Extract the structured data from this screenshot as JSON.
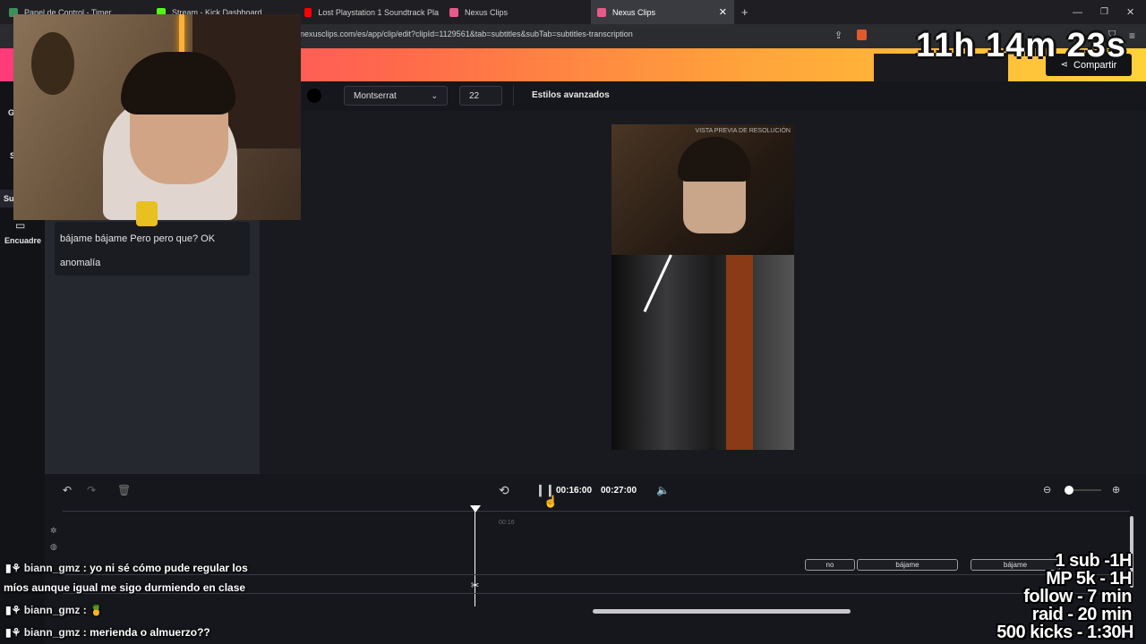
{
  "browser": {
    "tabs": [
      {
        "label": "Panel de Control - Timer",
        "icon_color": "#3a8f5a"
      },
      {
        "label": "Stream - Kick Dashboard",
        "icon_color": "#53fc18"
      },
      {
        "label": "Lost Playstation 1 Soundtrack Pla",
        "icon_color": "#ff0000"
      },
      {
        "label": "Nexus Clips",
        "icon_color": "#e85a8a"
      },
      {
        "label": "Nexus Clips",
        "icon_color": "#e85a8a"
      }
    ],
    "new_tab": "+",
    "url": "nexusclips.com/es/app/clip/edit?clipId=1129561&tab=subtitles&subTab=subtitles-transcription"
  },
  "header": {
    "share_label": "Compartir"
  },
  "sidebar": {
    "items": [
      {
        "label": "G"
      },
      {
        "label": "S"
      },
      {
        "label": "Su"
      },
      {
        "label": "Encuadre"
      }
    ]
  },
  "toolbar": {
    "font_value": "Montserrat",
    "size_value": "22",
    "advanced_label": "Estilos avanzados"
  },
  "subtitles": {
    "line1": "bájame bájame Pero pero que? OK",
    "line2": "anomalía"
  },
  "preview": {
    "watermark": "VISTA PREVIA DE RESOLUCIÓN"
  },
  "timeline": {
    "current_time": "00:16:00",
    "total_time": "00:27:00",
    "marker": "00:16",
    "clips": [
      {
        "label": "no"
      },
      {
        "label": "bájame"
      },
      {
        "label": "bájame"
      }
    ]
  },
  "overlay": {
    "timer": "11h 14m 23s",
    "goals": [
      "1 sub -1H",
      "MP 5k - 1H",
      "follow - 7 min",
      "raid - 20 min",
      "500 kicks - 1:30H"
    ],
    "chat": [
      {
        "user": "biann_gmz",
        "sep": ":",
        "text": "yo ni sé cómo pude regular los"
      },
      {
        "user": "",
        "sep": "",
        "text": "míos aunque igual me sigo durmiendo en clase"
      },
      {
        "user": "biann_gmz",
        "sep": ":",
        "text": ""
      },
      {
        "user": "biann_gmz",
        "sep": ":",
        "text": "merienda o almuerzo??"
      }
    ]
  }
}
